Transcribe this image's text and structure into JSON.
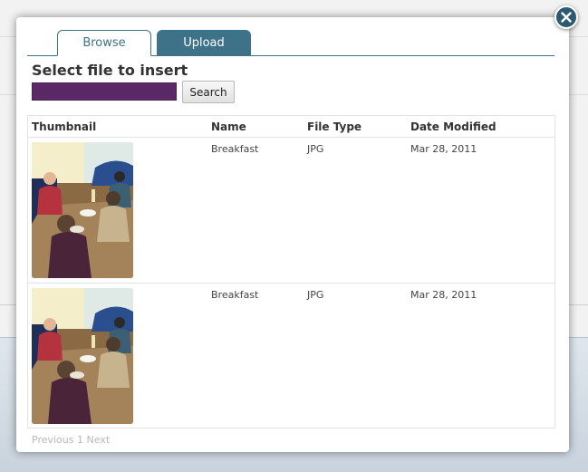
{
  "dialog": {
    "tabs": [
      {
        "label": "Browse",
        "active": true
      },
      {
        "label": "Upload",
        "active": false
      }
    ],
    "heading": "Select file to insert",
    "search": {
      "value": "",
      "button_label": "Search"
    },
    "table": {
      "columns": [
        "Thumbnail",
        "Name",
        "File Type",
        "Date Modified"
      ],
      "rows": [
        {
          "name": "Breakfast",
          "file_type": "JPG",
          "date_modified": "Mar 28, 2011"
        },
        {
          "name": "Breakfast",
          "file_type": "JPG",
          "date_modified": "Mar 28, 2011"
        }
      ]
    },
    "pagination": {
      "previous": "Previous",
      "page": "1",
      "next": "Next"
    },
    "close_icon": "close-icon"
  },
  "colors": {
    "accent": "#3d7289",
    "search_field": "#5b2a66",
    "close_button": "#2c5a70"
  }
}
